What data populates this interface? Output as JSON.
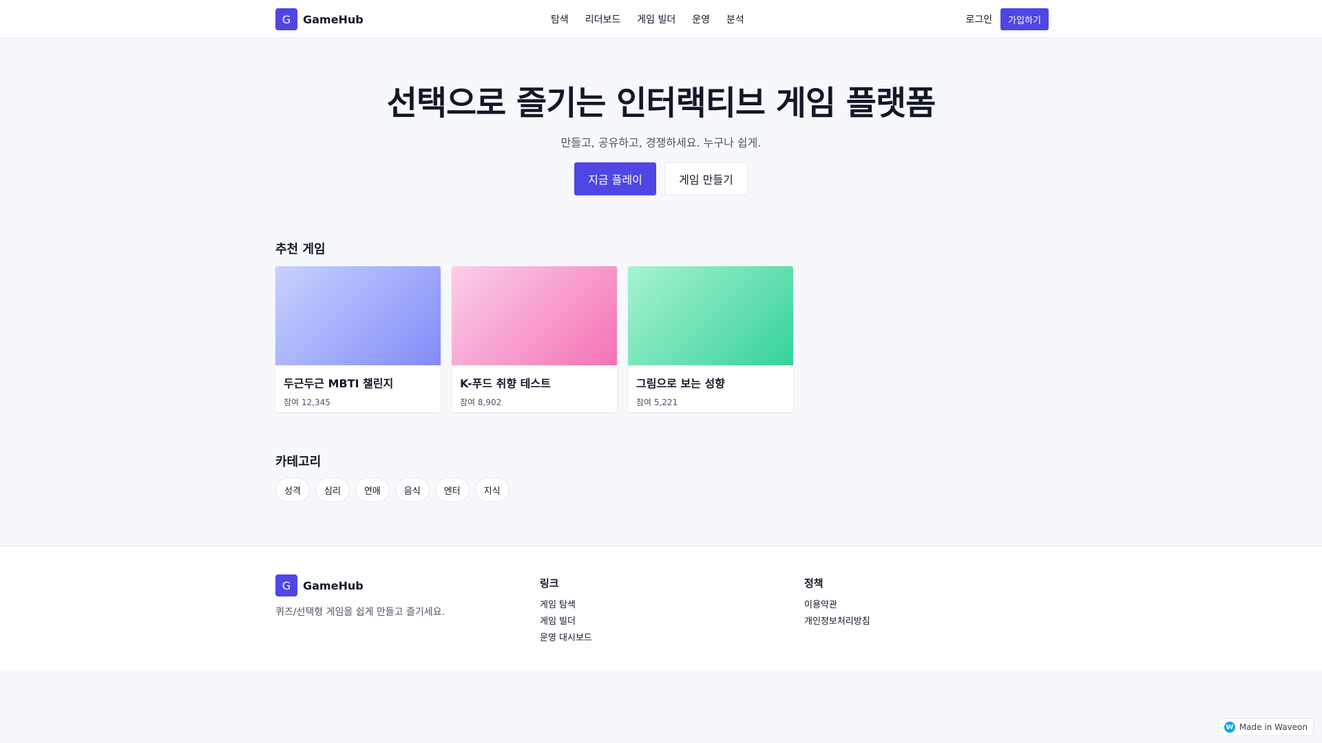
{
  "brand": {
    "logo_letter": "G",
    "name": "GameHub",
    "accent": "#4f46e5"
  },
  "header": {
    "nav": [
      "탐색",
      "리더보드",
      "게임 빌더",
      "운영",
      "분석"
    ],
    "login_label": "로그인",
    "signup_label": "가입하기"
  },
  "hero": {
    "title": "선택으로 즐기는 인터랙티브 게임 플랫폼",
    "subtitle": "만들고, 공유하고, 경쟁하세요. 누구나 쉽게.",
    "play_label": "지금 플레이",
    "create_label": "게임 만들기"
  },
  "featured": {
    "title": "추천 게임",
    "games": [
      {
        "title": "두근두근 MBTI 챌린지",
        "participants": "참여 12,345",
        "gradient": [
          "#c7d2fe",
          "#818cf8"
        ]
      },
      {
        "title": "K-푸드 취향 테스트",
        "participants": "참여 8,902",
        "gradient": [
          "#fbcfe8",
          "#f472b6"
        ]
      },
      {
        "title": "그림으로 보는 성향",
        "participants": "참여 5,221",
        "gradient": [
          "#a7f3d0",
          "#34d399"
        ]
      }
    ]
  },
  "categories": {
    "title": "카테고리",
    "items": [
      "성격",
      "심리",
      "연애",
      "음식",
      "엔터",
      "지식"
    ]
  },
  "footer": {
    "description": "퀴즈/선택형 게임을 쉽게 만들고 즐기세요.",
    "links_title": "링크",
    "links": [
      "게임 탐색",
      "게임 빌더",
      "운영 대시보드"
    ],
    "policy_title": "정책",
    "policies": [
      "이용약관",
      "개인정보처리방침"
    ]
  },
  "badge": {
    "icon": "waveon-icon",
    "letter": "W",
    "label": "Made in Waveon"
  }
}
